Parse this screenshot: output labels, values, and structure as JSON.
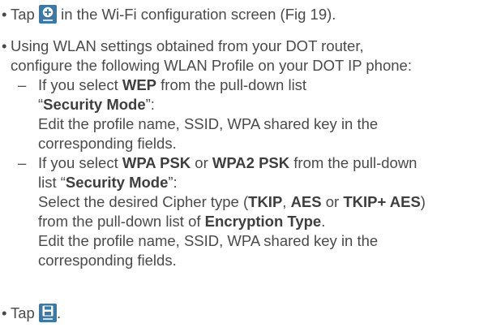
{
  "step1": {
    "bullet": "•",
    "pre": "Tap",
    "icon": "add-icon",
    "post": "in the Wi-Fi configuration screen (Fig 19)."
  },
  "step2": {
    "bullet": "•",
    "line1": "Using WLAN settings obtained from your DOT router,",
    "line2": "configure the following WLAN Profile on your DOT IP phone:",
    "sub1": {
      "dash": "–",
      "l1_pre": "If you select",
      "l1_bold": "WEP",
      "l1_post": "from the pull-down list",
      "l2_q1": "“",
      "l2_bold": "Security Mode",
      "l2_q2": "”:",
      "l3": "Edit the profile name, SSID, WPA shared key in the",
      "l4": "corresponding fields."
    },
    "sub2": {
      "dash": "–",
      "l1_pre": "If you select",
      "l1_b1": "WPA PSK",
      "l1_mid": "or",
      "l1_b2": "WPA2 PSK",
      "l1_post": "from the pull-down",
      "l2_pre": "list “",
      "l2_bold": "Security Mode",
      "l2_post": "”:",
      "l3_pre": "Select the desired Cipher type (",
      "l3_b1": "TKIP",
      "l3_c1": ",",
      "l3_b2": "AES",
      "l3_or": "or",
      "l3_b3": "TKIP+ AES",
      "l3_post": ")",
      "l4_pre": "from the pull-down list of",
      "l4_bold": "Encryption Type",
      "l4_post": ".",
      "l5": "Edit the profile name, SSID, WPA shared key in the",
      "l6": "corresponding fields."
    }
  },
  "step3": {
    "bullet": "•",
    "pre": "Tap",
    "icon": "save-icon",
    "post": "."
  }
}
